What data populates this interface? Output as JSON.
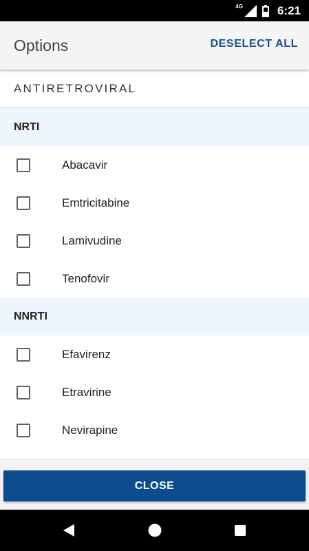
{
  "status_bar": {
    "network": "4G",
    "time": "6:21",
    "icons": [
      "signal-icon",
      "battery-icon"
    ]
  },
  "app_bar": {
    "title": "Options",
    "deselect_all_label": "DESELECT ALL"
  },
  "section": {
    "title": "ANTIRETROVIRAL"
  },
  "groups": [
    {
      "label": "NRTI",
      "items": [
        {
          "label": "Abacavir",
          "checked": false
        },
        {
          "label": "Emtricitabine",
          "checked": false
        },
        {
          "label": "Lamivudine",
          "checked": false
        },
        {
          "label": "Tenofovir",
          "checked": false
        }
      ]
    },
    {
      "label": "NNRTI",
      "items": [
        {
          "label": "Efavirenz",
          "checked": false
        },
        {
          "label": "Etravirine",
          "checked": false
        },
        {
          "label": "Nevirapine",
          "checked": false
        }
      ]
    }
  ],
  "footer": {
    "close_label": "CLOSE"
  },
  "nav_bar": {
    "icons": [
      "back-icon",
      "home-icon",
      "recents-icon"
    ]
  },
  "colors": {
    "accent": "#1a4f8b",
    "primary_button": "#0b4d8c",
    "group_header_bg": "#eef5fd",
    "app_bar_bg": "#f5f5f5"
  }
}
